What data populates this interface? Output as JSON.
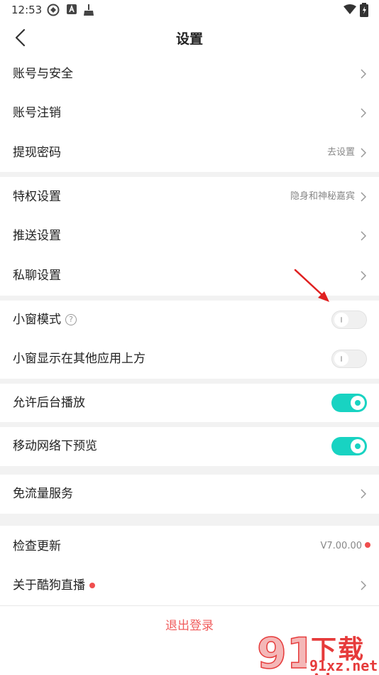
{
  "status_bar": {
    "time": "12:53"
  },
  "header": {
    "title": "设置"
  },
  "section1": [
    {
      "label": "账号与安全",
      "value": ""
    },
    {
      "label": "账号注销",
      "value": ""
    },
    {
      "label": "提现密码",
      "value": "去设置"
    }
  ],
  "section2": [
    {
      "label": "特权设置",
      "value": "隐身和神秘嘉宾"
    },
    {
      "label": "推送设置",
      "value": ""
    },
    {
      "label": "私聊设置",
      "value": ""
    }
  ],
  "section3": {
    "mini_window": {
      "label": "小窗模式",
      "help_icon": "?",
      "enabled": false
    },
    "mini_window_over_apps": {
      "label": "小窗显示在其他应用上方",
      "enabled": false
    }
  },
  "section4": {
    "background_play": {
      "label": "允许后台播放",
      "enabled": true
    }
  },
  "section5": {
    "mobile_preview": {
      "label": "移动网络下预览",
      "enabled": true
    }
  },
  "section6": {
    "free_data": {
      "label": "免流量服务"
    }
  },
  "section7": {
    "check_update": {
      "label": "检查更新",
      "version": "V7.00.00"
    },
    "about": {
      "label": "关于酷狗直播"
    }
  },
  "logout_label": "退出登录",
  "watermark": {
    "brand": "下载站",
    "url": "91xz.net",
    "logo_digits": "91"
  },
  "colors": {
    "accent": "#18d3c2",
    "danger": "#f05d5d",
    "divider": "#f2f2f2"
  }
}
